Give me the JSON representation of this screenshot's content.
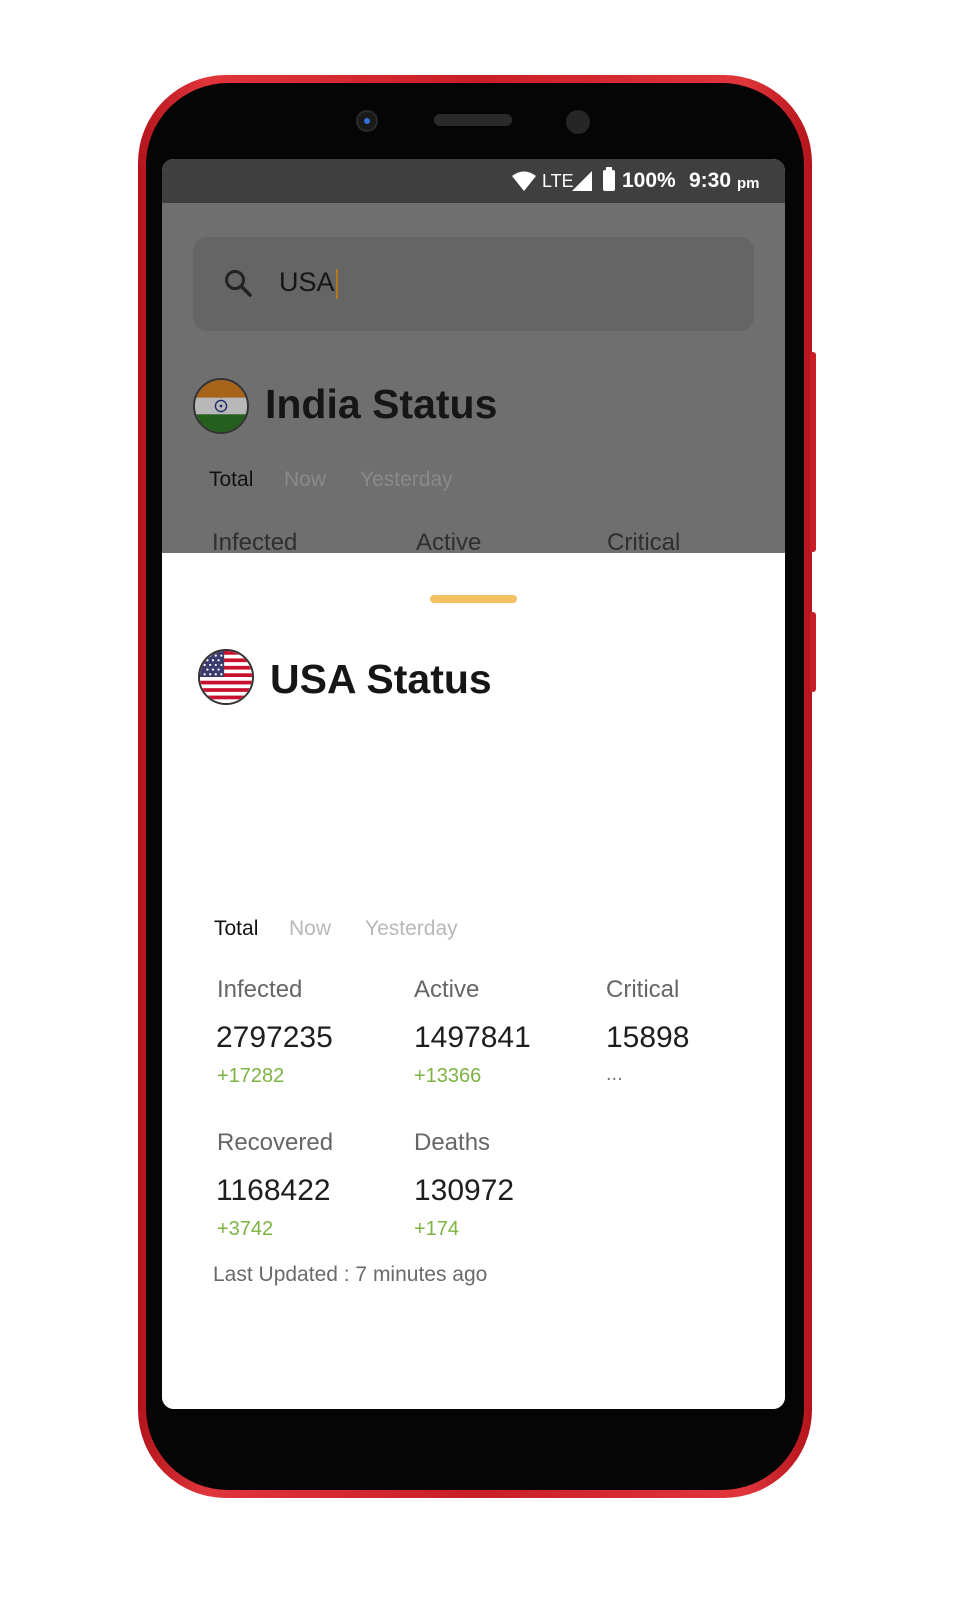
{
  "status_bar": {
    "network": "LTE",
    "battery": "100%",
    "time": "9:30",
    "ampm": "pm"
  },
  "search": {
    "value": "USA"
  },
  "background_card": {
    "title": "India Status",
    "tabs": [
      "Total",
      "Now",
      "Yesterday"
    ],
    "labels": [
      "Infected",
      "Active",
      "Critical"
    ]
  },
  "sheet": {
    "title": "USA Status",
    "tabs": [
      "Total",
      "Now",
      "Yesterday"
    ],
    "stats": [
      {
        "label": "Infected",
        "value": "2797235",
        "delta": "+17282"
      },
      {
        "label": "Active",
        "value": "1497841",
        "delta": "+13366"
      },
      {
        "label": "Critical",
        "value": "15898",
        "delta": "..."
      },
      {
        "label": "Recovered",
        "value": "1168422",
        "delta": "+3742"
      },
      {
        "label": "Deaths",
        "value": "130972",
        "delta": "+174"
      }
    ],
    "last_updated": "Last Updated : 7 minutes ago"
  },
  "colors": {
    "accent_handle": "#f4c061",
    "delta_green": "#7cb342",
    "phone_frame": "#c81e25"
  }
}
